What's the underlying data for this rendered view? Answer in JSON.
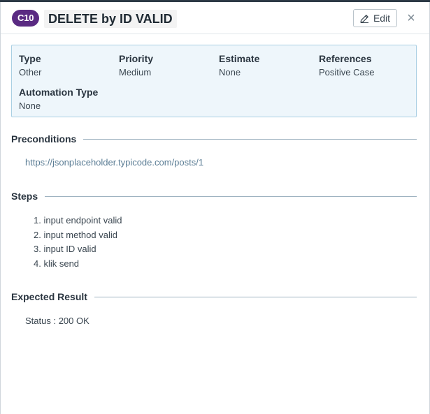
{
  "header": {
    "case_id": "C10",
    "title": "DELETE by ID VALID",
    "edit_label": "Edit",
    "close_glyph": "×"
  },
  "fields": [
    {
      "label": "Type",
      "value": "Other"
    },
    {
      "label": "Priority",
      "value": "Medium"
    },
    {
      "label": "Estimate",
      "value": "None"
    },
    {
      "label": "References",
      "value": "Positive Case"
    },
    {
      "label": "Automation Type",
      "value": "None"
    }
  ],
  "preconditions": {
    "title": "Preconditions",
    "link": "https://jsonplaceholder.typicode.com/posts/1"
  },
  "steps": {
    "title": "Steps",
    "items": [
      "1. input endpoint valid",
      "2. input method valid",
      "3. input ID valid",
      "4. klik send"
    ]
  },
  "expected": {
    "title": "Expected Result",
    "text": "Status : 200 OK"
  },
  "colors": {
    "badge": "#5a2a82",
    "fields_bg": "#eef6fb",
    "fields_border": "#a9cfe3",
    "link": "#5b7d95"
  },
  "icons": {
    "edit": "pencil-icon",
    "close": "close-icon"
  }
}
